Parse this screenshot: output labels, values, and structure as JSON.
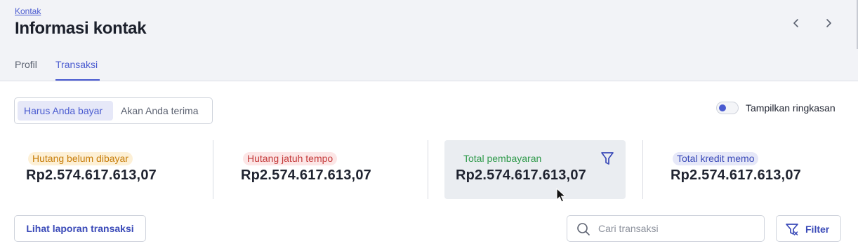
{
  "header": {
    "breadcrumb": "Kontak",
    "title": "Informasi kontak",
    "tabs": [
      {
        "label": "Profil",
        "active": false
      },
      {
        "label": "Transaksi",
        "active": true
      }
    ]
  },
  "segment": {
    "options": [
      {
        "label": "Harus Anda bayar",
        "active": true
      },
      {
        "label": "Akan Anda terima",
        "active": false
      }
    ]
  },
  "summary_toggle": {
    "label": "Tampilkan ringkasan",
    "on": false
  },
  "cards": [
    {
      "label": "Hutang belum dibayar",
      "amount": "Rp2.574.617.613,07",
      "color": "#c77d0a"
    },
    {
      "label": "Hutang jatuh tempo",
      "amount": "Rp2.574.617.613,07",
      "color": "#c43a3a"
    },
    {
      "label": "Total pembayaran",
      "amount": "Rp2.574.617.613,07",
      "color": "#2f9a4b",
      "selected": true,
      "icon": "filter-icon"
    },
    {
      "label": "Total kredit memo",
      "amount": "Rp2.574.617.613,07",
      "color": "#3a4ab8"
    }
  ],
  "actions": {
    "report_button": "Lihat laporan transaksi",
    "search_placeholder": "Cari transaksi",
    "search_value": "",
    "filter_button": "Filter"
  },
  "colors": {
    "accent": "#4a5bd0",
    "header_bg": "#f2f3f7"
  }
}
